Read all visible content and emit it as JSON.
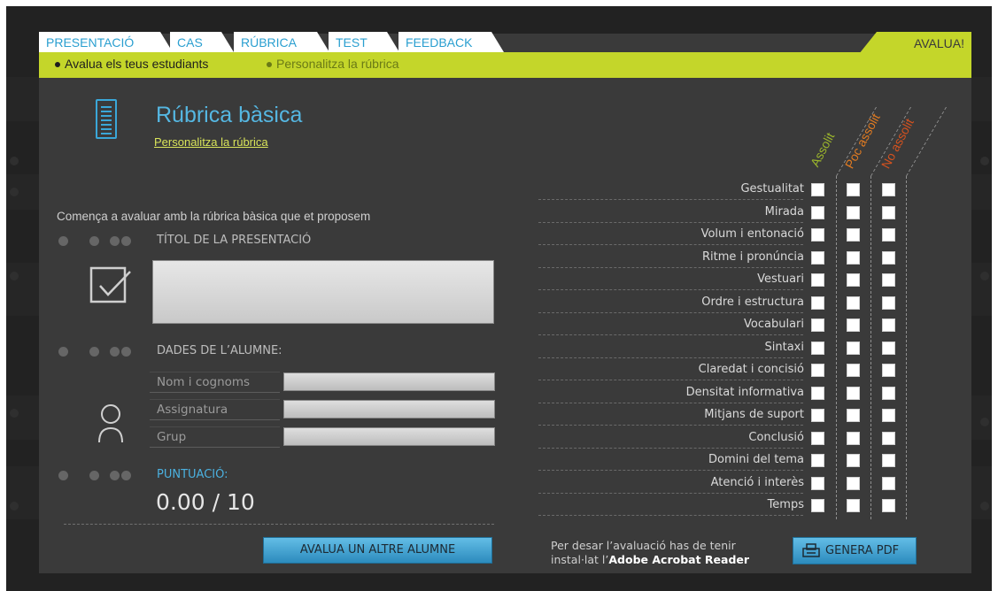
{
  "tabs": [
    {
      "label": "PRESENTACIÓ"
    },
    {
      "label": "CAS"
    },
    {
      "label": "RÚBRICA"
    },
    {
      "label": "TEST"
    },
    {
      "label": "FEEDBACK"
    }
  ],
  "action_tab": "AVALUA!",
  "subnav": {
    "active": "Avalua els teus estudiants",
    "inactive": "Personalitza la rúbrica"
  },
  "header": {
    "title": "Rúbrica bàsica",
    "link": "Personalitza la rúbrica"
  },
  "intro": "Comença a avaluar amb la rúbrica bàsica que et proposem",
  "presentation": {
    "label": "TÍTOL DE LA PRESENTACIÓ",
    "value": ""
  },
  "student": {
    "label": "DADES DE L’ALUMNE:",
    "fields": [
      {
        "label": "Nom i cognoms",
        "value": ""
      },
      {
        "label": "Assignatura",
        "value": ""
      },
      {
        "label": "Grup",
        "value": ""
      }
    ]
  },
  "score": {
    "label": "PUNTUACIÓ:",
    "value": "0.00 / 10"
  },
  "another_button": "AVALUA UN ALTRE ALUMNE",
  "rubric": {
    "columns": [
      {
        "label": "Assolit",
        "color": "#9bb52c"
      },
      {
        "label": "Poc assolit",
        "color": "#e07b22"
      },
      {
        "label": "No assolit",
        "color": "#d4521f"
      }
    ],
    "criteria": [
      {
        "name": "Gestualitat"
      },
      {
        "name": "Mirada"
      },
      {
        "name": "Volum i entonació"
      },
      {
        "name": "Ritme i pronúncia"
      },
      {
        "name": "Vestuari"
      },
      {
        "name": "Ordre i estructura"
      },
      {
        "name": "Vocabulari"
      },
      {
        "name": "Sintaxi"
      },
      {
        "name": "Claredat  i concisió"
      },
      {
        "name": "Densitat informativa"
      },
      {
        "name": "Mitjans de suport"
      },
      {
        "name": "Conclusió"
      },
      {
        "name": "Domini del tema"
      },
      {
        "name": "Atenció i interès"
      },
      {
        "name": "Temps"
      }
    ]
  },
  "pdf": {
    "note_line1": "Per desar l’avaluació has de tenir",
    "note_line2_prefix": "instal·lat l’",
    "note_line2_bold": "Adobe Acrobat Reader",
    "button": "GENERA PDF"
  },
  "colors": {
    "accent_green": "#c4d62a",
    "accent_blue": "#3aa7d8",
    "panel": "#3a3a3a"
  }
}
